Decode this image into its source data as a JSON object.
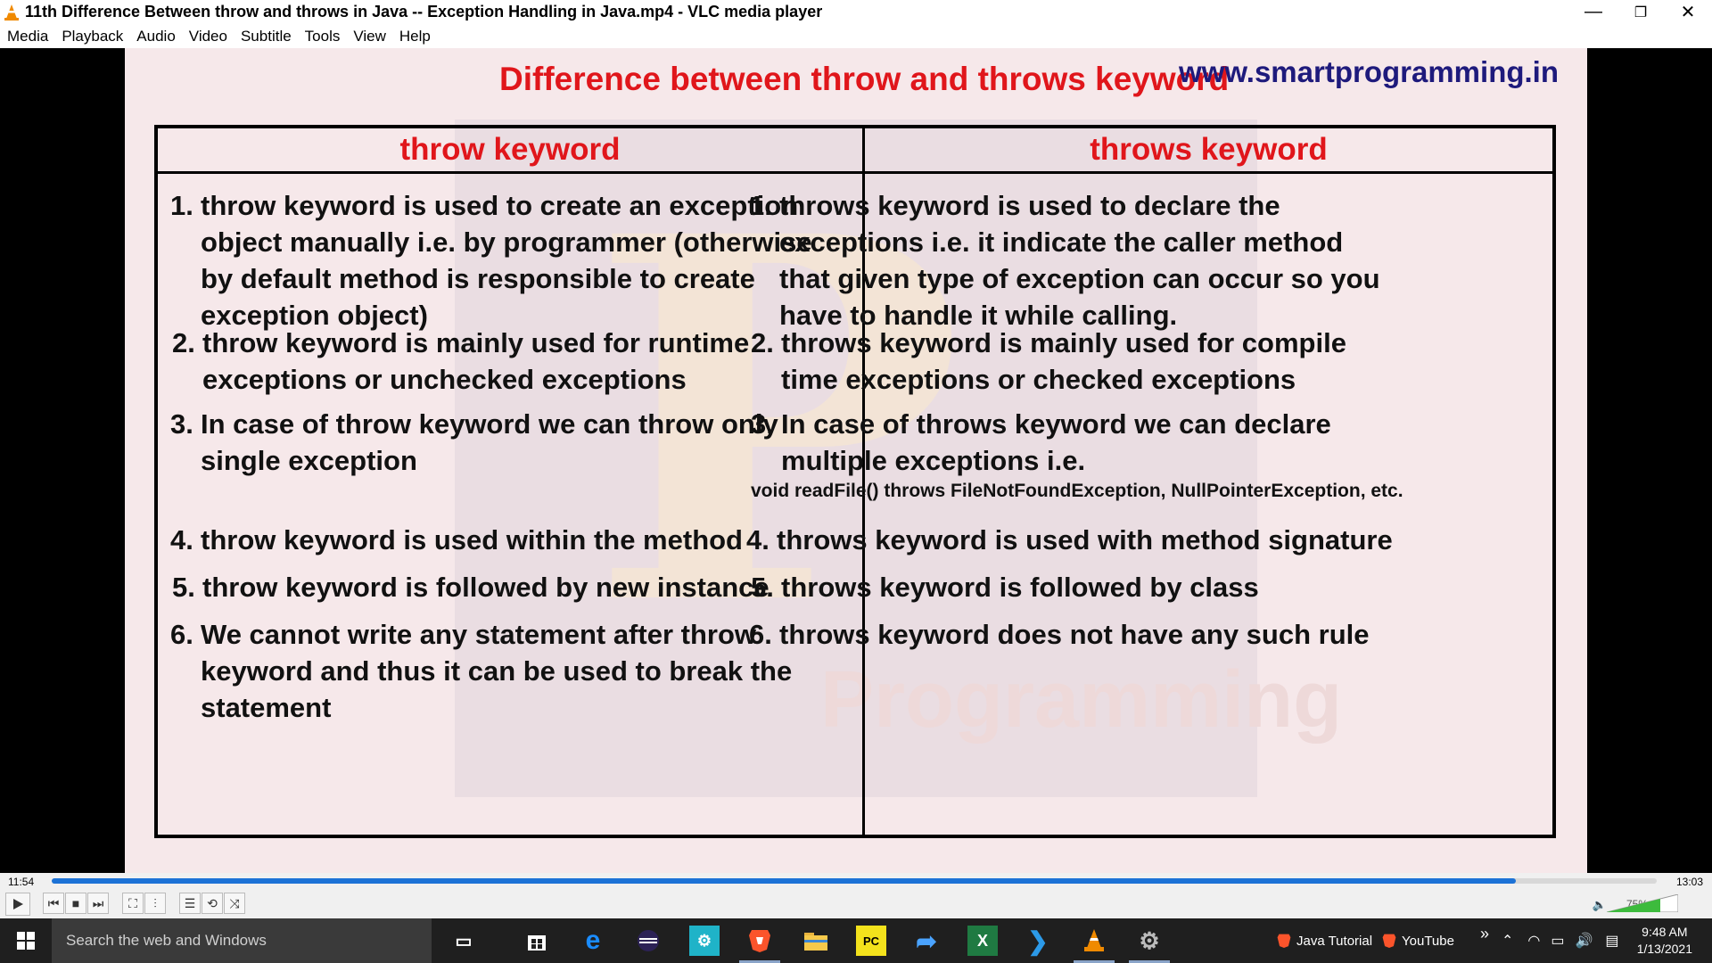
{
  "window": {
    "title": "11th Difference Between throw and throws in Java -- Exception Handling in Java.mp4 - VLC media player",
    "minimize": "—",
    "restore": "❐",
    "close": "✕"
  },
  "menu": [
    "Media",
    "Playback",
    "Audio",
    "Video",
    "Subtitle",
    "Tools",
    "View",
    "Help"
  ],
  "slide": {
    "title": "Difference between throw and throws keyword",
    "site": "www.smartprogramming.in",
    "watermark": "Programming",
    "left_header": "throw keyword",
    "right_header": "throws keyword",
    "left_points": [
      {
        "n": "1.",
        "lines": [
          "throw keyword is used to create an exception",
          "object manually i.e. by programmer (otherwise",
          "by default method is responsible to create",
          "exception object)"
        ]
      },
      {
        "n": "2.",
        "lines": [
          "throw keyword is mainly used for runtime",
          "exceptions or unchecked exceptions"
        ]
      },
      {
        "n": "3.",
        "lines": [
          "In case of throw keyword we can throw only",
          "single exception"
        ]
      },
      {
        "n": "4.",
        "lines": [
          "throw keyword is used within the method"
        ]
      },
      {
        "n": "5.",
        "lines": [
          "throw keyword is followed by new instance"
        ]
      },
      {
        "n": "6.",
        "lines": [
          "We cannot write any statement after throw",
          "keyword and thus it can be used to break the",
          "statement"
        ]
      }
    ],
    "right_points": [
      {
        "n": "1.",
        "lines": [
          "throws keyword is used to declare the",
          "exceptions i.e. it indicate the caller method",
          "that given type of exception can occur so you",
          "have to handle it while calling."
        ]
      },
      {
        "n": "2.",
        "lines": [
          "throws keyword is mainly used for compile",
          "time exceptions or checked exceptions"
        ]
      },
      {
        "n": "3.",
        "lines": [
          "In case of throws keyword we can declare",
          "multiple exceptions i.e."
        ]
      },
      {
        "n": "",
        "lines": [
          "void readFile() throws FileNotFoundException, NullPointerException, etc."
        ]
      },
      {
        "n": "4.",
        "lines": [
          "throws keyword is used with method signature"
        ]
      },
      {
        "n": "5.",
        "lines": [
          "throws keyword is followed by class"
        ]
      },
      {
        "n": "6.",
        "lines": [
          "throws keyword does not have any such rule"
        ]
      }
    ]
  },
  "player": {
    "elapsed": "11:54",
    "total": "13:03",
    "progress_fraction": 0.912,
    "volume_label": "75%",
    "volume_fraction": 0.75
  },
  "taskbar": {
    "search_placeholder": "Search the web and Windows",
    "app1": "Java Tutorial",
    "app2": "YouTube",
    "overflow": "»",
    "time": "9:48 AM",
    "date": "1/13/2021"
  },
  "colors": {
    "slide_title": "#e0161b",
    "site": "#1e1a7c",
    "seek": "#1c72d6",
    "taskbar": "#1f1f1f"
  }
}
